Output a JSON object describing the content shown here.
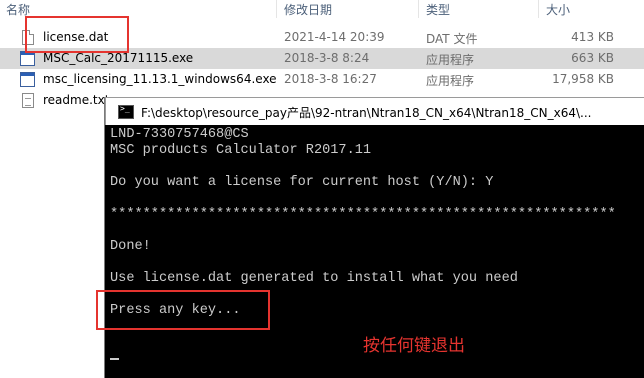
{
  "explorer": {
    "columns": {
      "name": "名称",
      "modified": "修改日期",
      "type": "类型",
      "size": "大小"
    },
    "files": [
      {
        "name": "license.dat",
        "modified": "2021-4-14 20:39",
        "type": "DAT 文件",
        "size": "413 KB",
        "icon": "document-icon"
      },
      {
        "name": "MSC_Calc_20171115.exe",
        "modified": "2018-3-8 8:24",
        "type": "应用程序",
        "size": "663 KB",
        "icon": "exe-icon"
      },
      {
        "name": "msc_licensing_11.13.1_windows64.exe",
        "modified": "2018-3-8 16:27",
        "type": "应用程序",
        "size": "17,958 KB",
        "icon": "exe-icon"
      },
      {
        "name": "readme.txt",
        "modified": "",
        "type": "",
        "size": "",
        "icon": "text-file-icon"
      }
    ]
  },
  "console": {
    "title": "F:\\desktop\\resource_pay产品\\92-ntran\\Ntran18_CN_x64\\Ntran18_CN_x64\\...",
    "lines": [
      "LND-7330757468@CS",
      "MSC products Calculator R2017.11",
      "",
      "Do you want a license for current host (Y/N): Y",
      "",
      "**************************************************************",
      "",
      "Done!",
      "",
      "Use license.dat generated to install what you need",
      "",
      "Press any key..."
    ]
  },
  "annotation": {
    "text": "按任何键退出",
    "color": "#e5342f"
  },
  "colors": {
    "highlight": "#e5342f",
    "selected_row": "#d9d9d9",
    "console_bg": "#000000",
    "console_fg": "#cccccc"
  }
}
